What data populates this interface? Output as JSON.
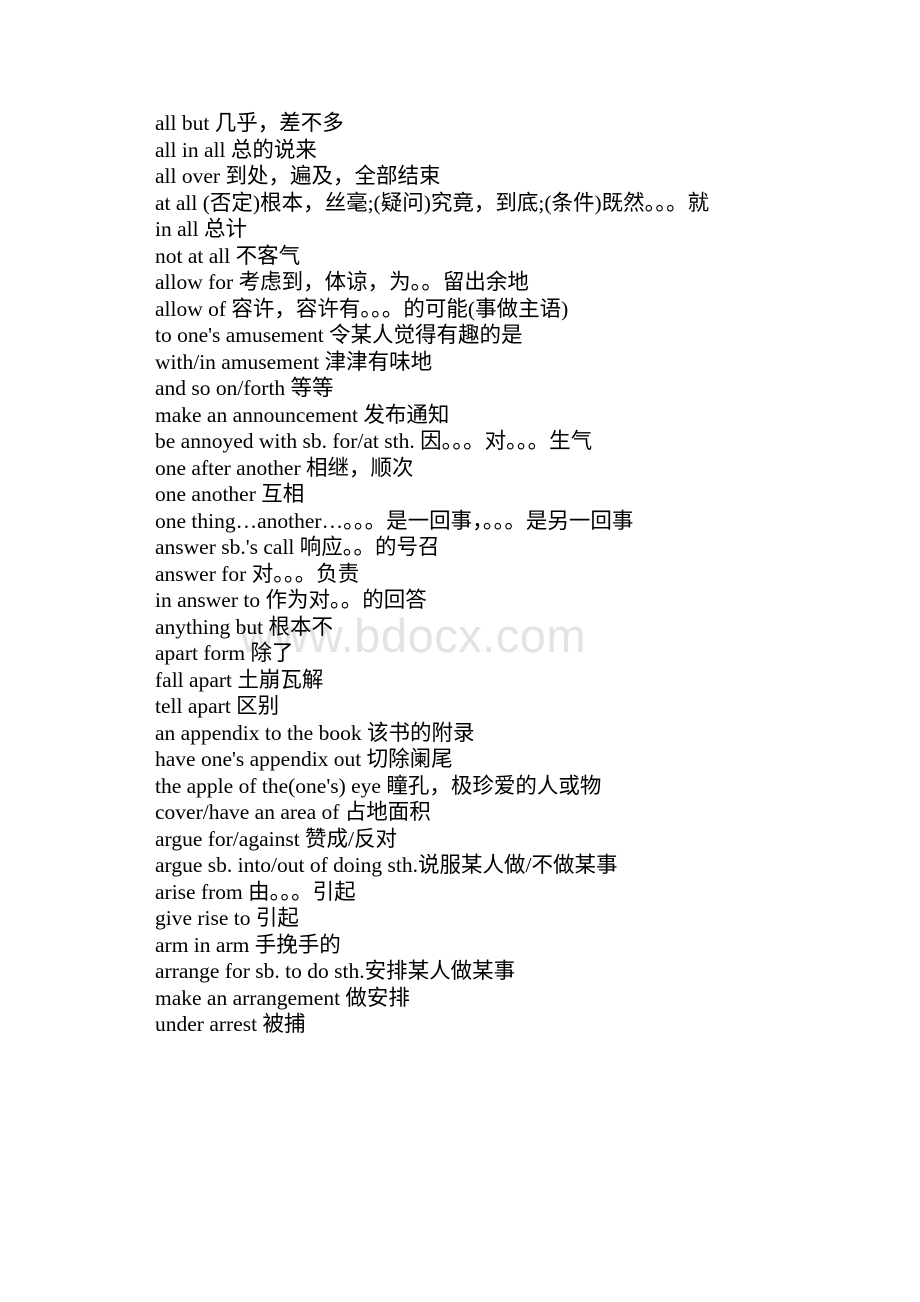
{
  "document": {
    "background_color": "#ffffff",
    "text_color": "#000000",
    "watermark": {
      "text": "www.bdocx.com",
      "color": "#e3e3e3"
    },
    "entries": [
      {
        "text": "all but 几乎，差不多"
      },
      {
        "text": "all in all 总的说来"
      },
      {
        "text": "all over 到处，遍及，全部结束"
      },
      {
        "text": "at all (否定)根本，丝毫;(疑问)究竟，到底;(条件)既然。。。就"
      },
      {
        "text": "in all 总计"
      },
      {
        "text": "not at all 不客气"
      },
      {
        "text": "allow for 考虑到，体谅，为。。留出余地"
      },
      {
        "text": "allow of 容许，容许有。。。的可能(事做主语)"
      },
      {
        "text": "to one's amusement 令某人觉得有趣的是"
      },
      {
        "text": "with/in amusement 津津有味地"
      },
      {
        "text": "and so on/forth 等等"
      },
      {
        "text": "make an announcement 发布通知"
      },
      {
        "text": "be annoyed with sb. for/at sth. 因。。。对。。。生气"
      },
      {
        "text": "one after another 相继，顺次"
      },
      {
        "text": "one another 互相"
      },
      {
        "text": "one thing…another…。。。是一回事，。。。是另一回事"
      },
      {
        "text": "answer sb.'s call 响应。。的号召"
      },
      {
        "text": "answer for 对。。。负责"
      },
      {
        "text": "in answer to 作为对。。的回答"
      },
      {
        "text": "anything but 根本不"
      },
      {
        "text": "apart form 除了"
      },
      {
        "text": "fall apart 土崩瓦解"
      },
      {
        "text": "tell apart 区别"
      },
      {
        "text": "an appendix to the book 该书的附录"
      },
      {
        "text": "have one's appendix out 切除阑尾"
      },
      {
        "text": "the apple of the(one's) eye 瞳孔，极珍爱的人或物"
      },
      {
        "text": "cover/have an area of 占地面积"
      },
      {
        "text": "argue for/against 赞成/反对"
      },
      {
        "text": "argue sb. into/out of doing sth.说服某人做/不做某事"
      },
      {
        "text": "arise from 由。。。引起"
      },
      {
        "text": "give rise to 引起"
      },
      {
        "text": "arm in arm 手挽手的"
      },
      {
        "text": "arrange for sb. to do sth.安排某人做某事"
      },
      {
        "text": "make an arrangement 做安排"
      },
      {
        "text": "under arrest 被捕"
      }
    ]
  }
}
